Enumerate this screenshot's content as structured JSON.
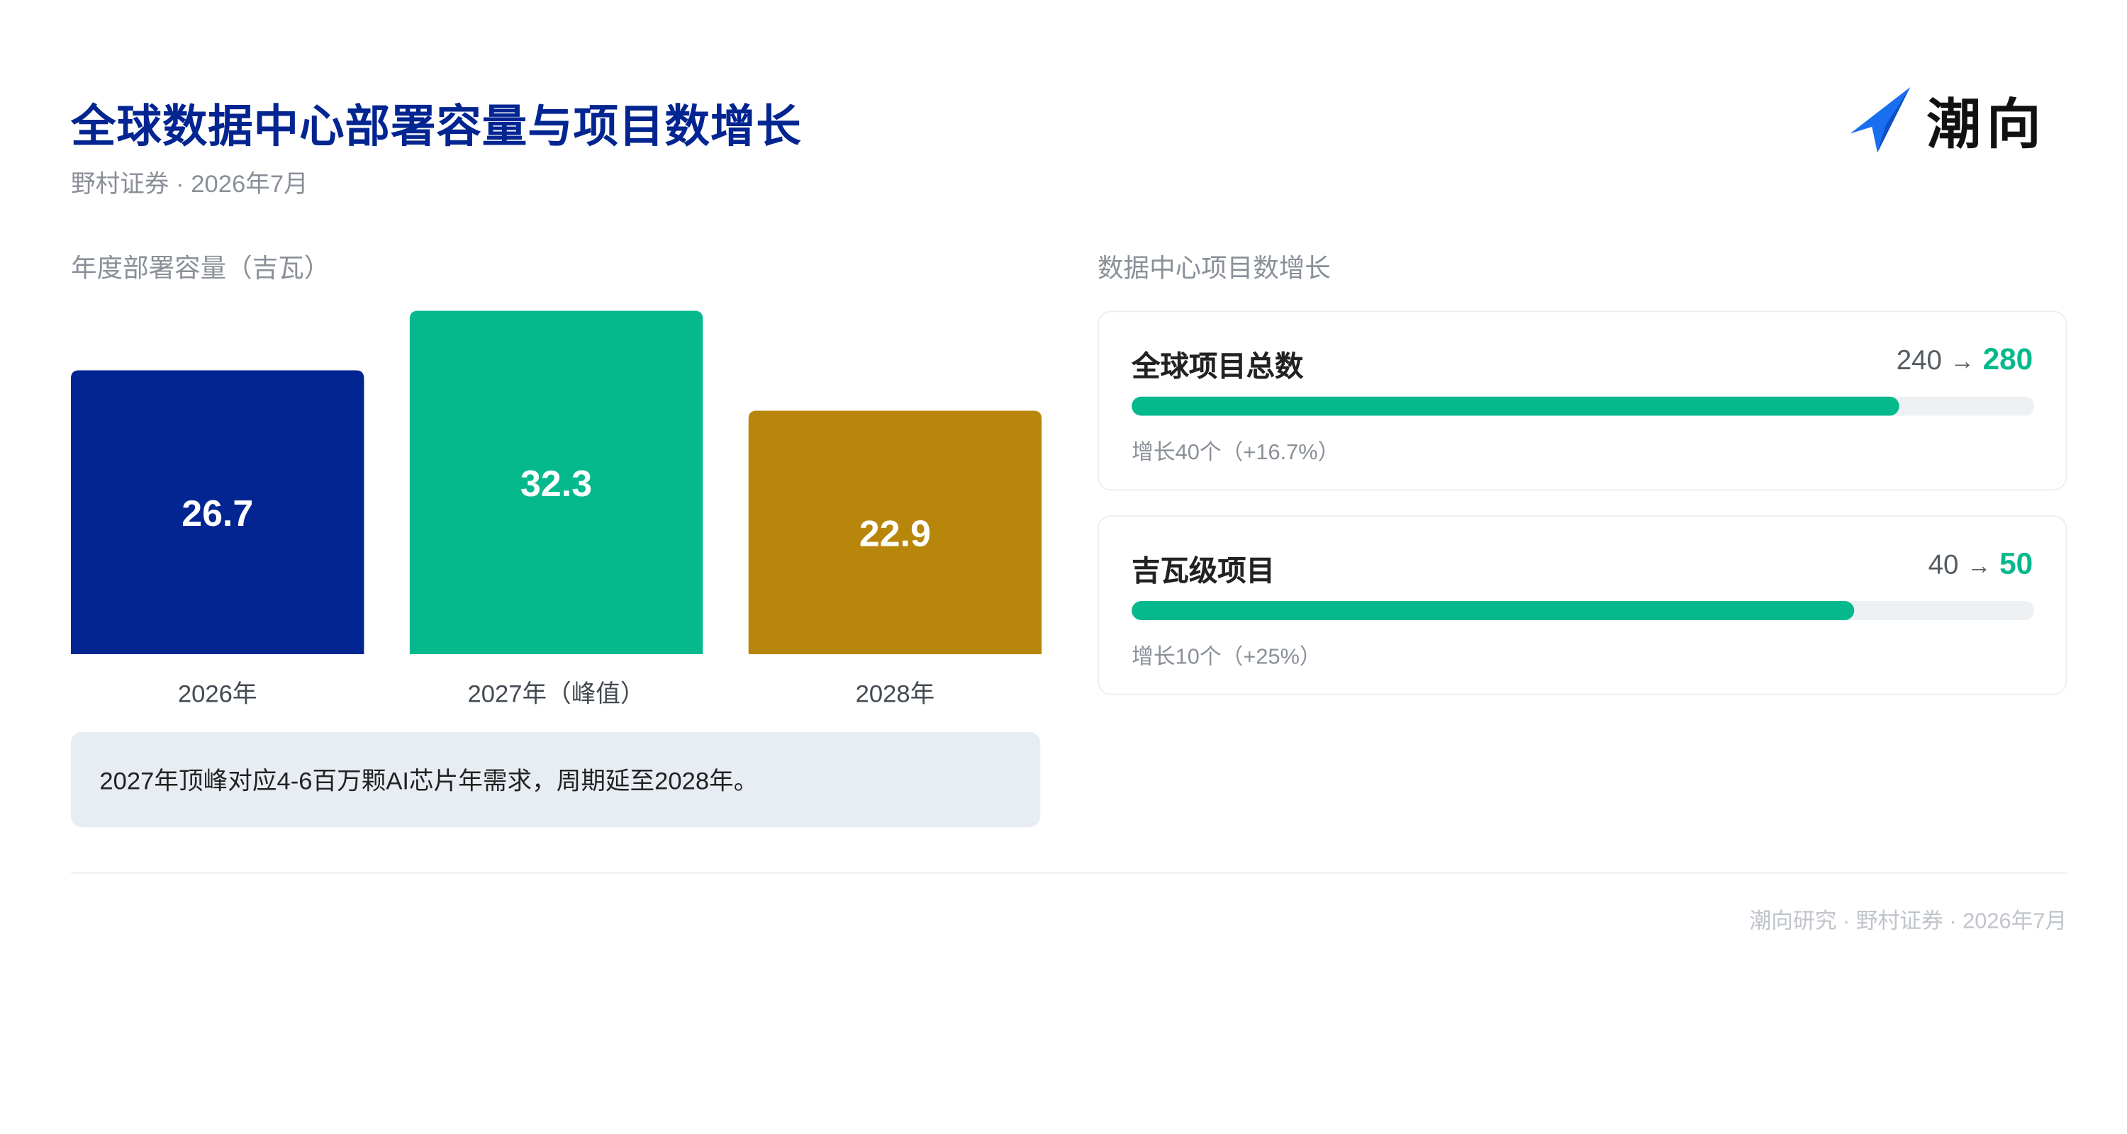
{
  "header": {
    "title": "全球数据中心部署容量与项目数增长",
    "subtitle": "野村证券 · 2026年7月",
    "logo_text": "潮向",
    "logo_icon": "arrow-logo-icon"
  },
  "colors": {
    "title": "#032591",
    "accent_green": "#05B98D",
    "bar_2026": "#032591",
    "bar_2027": "#05B98D",
    "bar_2028": "#B8860B",
    "note_bg": "#E8EDF3"
  },
  "left_section": {
    "label": "年度部署容量（吉瓦）"
  },
  "chart_data": {
    "type": "bar",
    "title": "年度部署容量（吉瓦）",
    "categories": [
      "2026年",
      "2027年（峰值）",
      "2028年"
    ],
    "values": [
      26.7,
      32.3,
      22.9
    ],
    "value_labels": [
      "26.7",
      "32.3",
      "22.9"
    ],
    "colors": [
      "#032591",
      "#05B98D",
      "#B8860B"
    ],
    "ylim": [
      0,
      32.3
    ],
    "grid": false,
    "legend": "none"
  },
  "note": {
    "text": "2027年顶峰对应4-6百万颗AI芯片年需求，周期延至2028年。"
  },
  "right_section": {
    "label": "数据中心项目数增长",
    "cards": [
      {
        "name": "全球项目总数",
        "from": "240",
        "arrow": "→",
        "to": "280",
        "progress": 0.85,
        "note": "增长40个（+16.7%）"
      },
      {
        "name": "吉瓦级项目",
        "from": "40",
        "arrow": "→",
        "to": "50",
        "progress": 0.8,
        "note": "增长10个（+25%）"
      }
    ]
  },
  "footer": {
    "text": "潮向研究 · 野村证券 · 2026年7月"
  }
}
